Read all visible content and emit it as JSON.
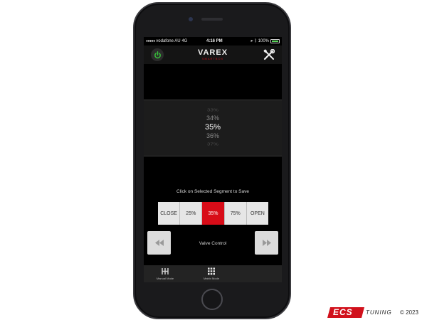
{
  "status_bar": {
    "carrier": "vodafone AU",
    "network": "4G",
    "time": "4:16 PM",
    "battery_percent": "100%",
    "battery_level": 1.0
  },
  "header": {
    "logo_main": "VAREX",
    "logo_sub": "SMARTBOX",
    "power_icon": "power-icon",
    "tools_icon": "wrench-screwdriver-icon",
    "power_color": "#37c23a"
  },
  "picker": {
    "values": [
      "33%",
      "34%",
      "35%",
      "36%",
      "37%"
    ],
    "selected": "35%"
  },
  "instruction": "Click on Selected Segment to Save",
  "segments": [
    {
      "label": "CLOSE",
      "selected": false
    },
    {
      "label": "25%",
      "selected": false
    },
    {
      "label": "35%",
      "selected": true
    },
    {
      "label": "75%",
      "selected": false
    },
    {
      "label": "OPEN",
      "selected": false
    }
  ],
  "valve_control": {
    "label": "Valve Control",
    "prev_icon": "rewind-icon",
    "next_icon": "fast-forward-icon"
  },
  "tabs": [
    {
      "label": "Manual Mode",
      "icon": "manual-mode-icon"
    },
    {
      "label": "Matrix Mode",
      "icon": "grid-icon"
    }
  ],
  "watermark": {
    "brand": "ECS",
    "brand_suffix": "TUNING",
    "copyright": "© 2023"
  },
  "colors": {
    "accent_red": "#d80c18",
    "segment_bg": "#e6e6e6"
  }
}
